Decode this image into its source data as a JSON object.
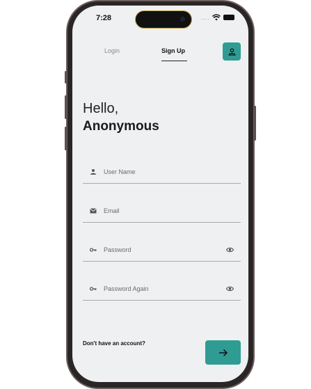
{
  "status_bar": {
    "time": "7:28",
    "signal_dots": "....",
    "wifi_icon": "wifi-icon",
    "battery_icon": "battery-icon"
  },
  "tabs": [
    {
      "label": "Login",
      "active": false
    },
    {
      "label": "Sign Up",
      "active": true
    }
  ],
  "profile_button": {
    "icon": "person-icon"
  },
  "greeting": {
    "hello": "Hello,",
    "name": "Anonymous"
  },
  "form": {
    "username": {
      "value": "",
      "placeholder": "User Name",
      "icon": "person-icon"
    },
    "email": {
      "value": "",
      "placeholder": "Email",
      "icon": "mail-icon"
    },
    "password": {
      "value": "",
      "placeholder": "Password",
      "icon": "key-icon",
      "toggle_icon": "eye-icon"
    },
    "password_again": {
      "value": "",
      "placeholder": "Password Again",
      "icon": "key-icon",
      "toggle_icon": "eye-icon"
    }
  },
  "footer": {
    "no_account": "Don't have an account?",
    "submit_icon": "arrow-right-icon"
  },
  "colors": {
    "accent": "#2f9c93",
    "screen_bg": "#eef0f2",
    "frame": "#2b2626"
  }
}
